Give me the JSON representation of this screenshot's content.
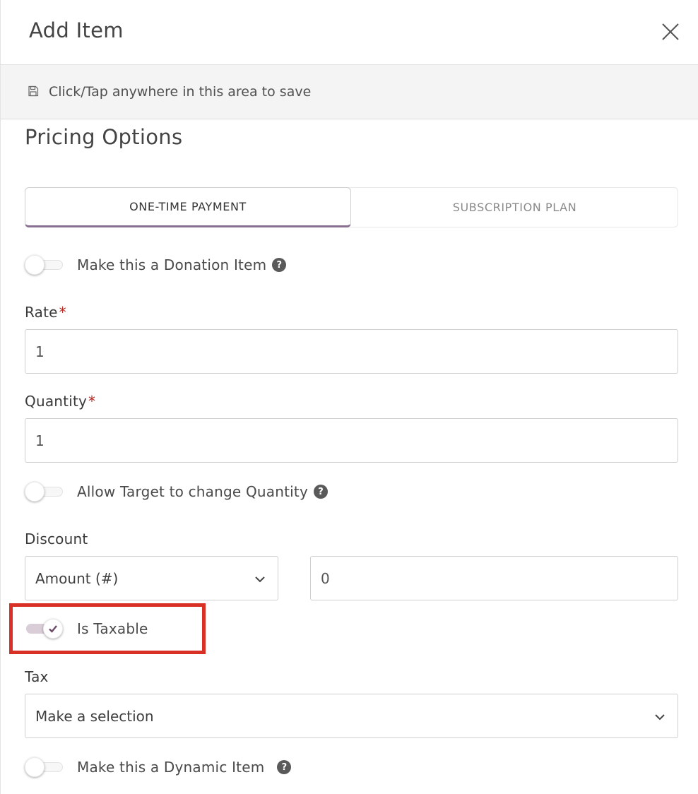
{
  "header": {
    "title": "Add Item"
  },
  "savebar": {
    "text": "Click/Tap anywhere in this area to save"
  },
  "section": {
    "title": "Pricing Options"
  },
  "tabs": [
    {
      "label": "ONE-TIME PAYMENT",
      "active": true
    },
    {
      "label": "SUBSCRIPTION PLAN",
      "active": false
    }
  ],
  "donation": {
    "label": "Make this a Donation Item",
    "on": false,
    "help": "?"
  },
  "rate": {
    "label": "Rate",
    "required": "*",
    "value": "1"
  },
  "quantity": {
    "label": "Quantity",
    "required": "*",
    "value": "1"
  },
  "allow_change_qty": {
    "label": "Allow Target to change Quantity",
    "on": false,
    "help": "?"
  },
  "discount": {
    "label": "Discount",
    "type": "Amount (#)",
    "value": "0"
  },
  "taxable": {
    "label": "Is Taxable",
    "on": true
  },
  "tax": {
    "label": "Tax",
    "placeholder": "Make a selection"
  },
  "dynamic": {
    "label": "Make this a Dynamic Item",
    "on": false,
    "help": "?"
  },
  "colors": {
    "accent": "#8a7090",
    "highlight": "#d93025",
    "required": "#b3261e",
    "toggle_on_track": "#d9cdd7"
  }
}
